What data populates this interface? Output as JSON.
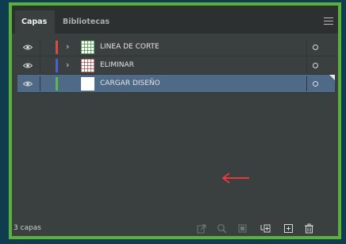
{
  "tabs": [
    {
      "label": "Capas"
    },
    {
      "label": "Bibliotecas"
    }
  ],
  "layers": [
    {
      "name": "LINEA DE CORTE",
      "color": "#d94b4b",
      "selected": false,
      "has_children": true
    },
    {
      "name": "ELIMINAR",
      "color": "#4a62c9",
      "selected": false,
      "has_children": true
    },
    {
      "name": "CARGAR DISEÑO",
      "color": "#5cb84f",
      "selected": true,
      "has_children": false
    }
  ],
  "footer": {
    "count_text": "3 capas"
  },
  "colors": {
    "frame_border": "#59b03a",
    "panel_bg": "#3a3f3f",
    "selected_row": "#4e6a87",
    "arrow": "#e03a3a"
  },
  "icons": [
    "menu-icon",
    "eye-icon",
    "chevron-right-icon",
    "target-circle-icon",
    "export-icon",
    "search-icon",
    "clip-mask-icon",
    "new-sublayer-icon",
    "new-layer-icon",
    "trash-icon",
    "arrow-left-icon"
  ]
}
